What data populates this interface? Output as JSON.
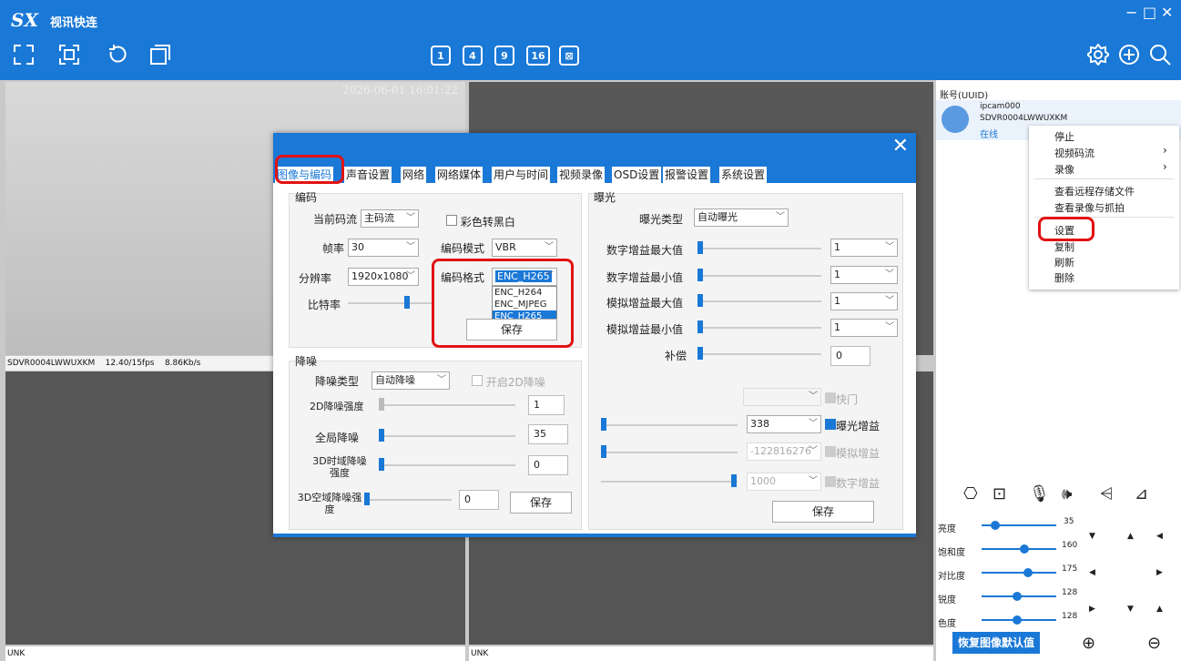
{
  "app": {
    "logo": "SX",
    "title": "视讯快连",
    "win_min": "−",
    "win_max": "□",
    "win_close": "✕"
  },
  "toolbar": {
    "grid": [
      "1",
      "4",
      "9",
      "16",
      "⊠"
    ]
  },
  "videos": [
    {
      "timestamp": "2026-06-01 16:01:22",
      "device": "SDVR0004LWWUXKM",
      "fps": "12.40/15fps",
      "rate": "8.86Kb/s"
    },
    {
      "label": "UNK"
    },
    {
      "label": "UNK"
    }
  ],
  "dialog": {
    "close": "✕",
    "tabs": [
      "图像与编码",
      "声音设置",
      "网络",
      "网络媒体",
      "用户与时间",
      "视频录像",
      "OSD设置",
      "报警设置",
      "系统设置"
    ],
    "encode": {
      "title": "编码",
      "stream_label": "当前码流",
      "stream_value": "主码流",
      "color_bw_label": "彩色转黑白",
      "fps_label": "帧率",
      "fps_value": "30",
      "mode_label": "编码模式",
      "mode_value": "VBR",
      "res_label": "分辨率",
      "res_value": "1920x1080",
      "format_label": "编码格式",
      "format_value": "ENC_H265",
      "format_options": [
        "ENC_H264",
        "ENC_MJPEG",
        "ENC_H265"
      ],
      "bitrate_label": "比特率",
      "save": "保存"
    },
    "exposure": {
      "title": "曝光",
      "type_label": "曝光类型",
      "type_value": "自动曝光",
      "dgain_max_label": "数字增益最大值",
      "dgain_max_value": "1",
      "dgain_min_label": "数字增益最小值",
      "dgain_min_value": "1",
      "again_max_label": "模拟增益最大值",
      "again_max_value": "1",
      "again_min_label": "模拟增益最小值",
      "again_min_value": "1",
      "comp_label": "补偿",
      "comp_value": "0",
      "shutter_label": "快门",
      "exp_gain_value": "338",
      "exp_gain_label": "曝光增益",
      "analog_value": "-122816276",
      "analog_label": "模拟增益",
      "digital_value": "1000",
      "digital_label": "数字增益",
      "save": "保存"
    },
    "noise": {
      "title": "降噪",
      "type_label": "降噪类型",
      "type_value": "自动降噪",
      "enable2d_label": "开启2D降噪",
      "strength2d_label": "2D降噪强度",
      "strength2d_value": "1",
      "global_label": "全局降噪",
      "global_value": "35",
      "temporal3d_label": "3D时域降噪强度",
      "temporal3d_value": "0",
      "spatial3d_label": "3D空域降噪强度",
      "spatial3d_value": "0",
      "save": "保存"
    }
  },
  "right": {
    "header": "账号(UUID)",
    "cam_name": "ipcam000",
    "cam_id": "SDVR0004LWWUXKM",
    "cam_status": "在线",
    "menu": [
      "停止",
      "视频码流",
      "录像",
      "查看远程存储文件",
      "查看录像与抓拍",
      "设置",
      "复制",
      "刷新",
      "删除"
    ],
    "image": [
      {
        "label": "亮度",
        "value": "35"
      },
      {
        "label": "饱和度",
        "value": "160"
      },
      {
        "label": "对比度",
        "value": "175"
      },
      {
        "label": "锐度",
        "value": "128"
      },
      {
        "label": "色度",
        "value": "128"
      }
    ],
    "restore": "恢复图像默认值"
  }
}
